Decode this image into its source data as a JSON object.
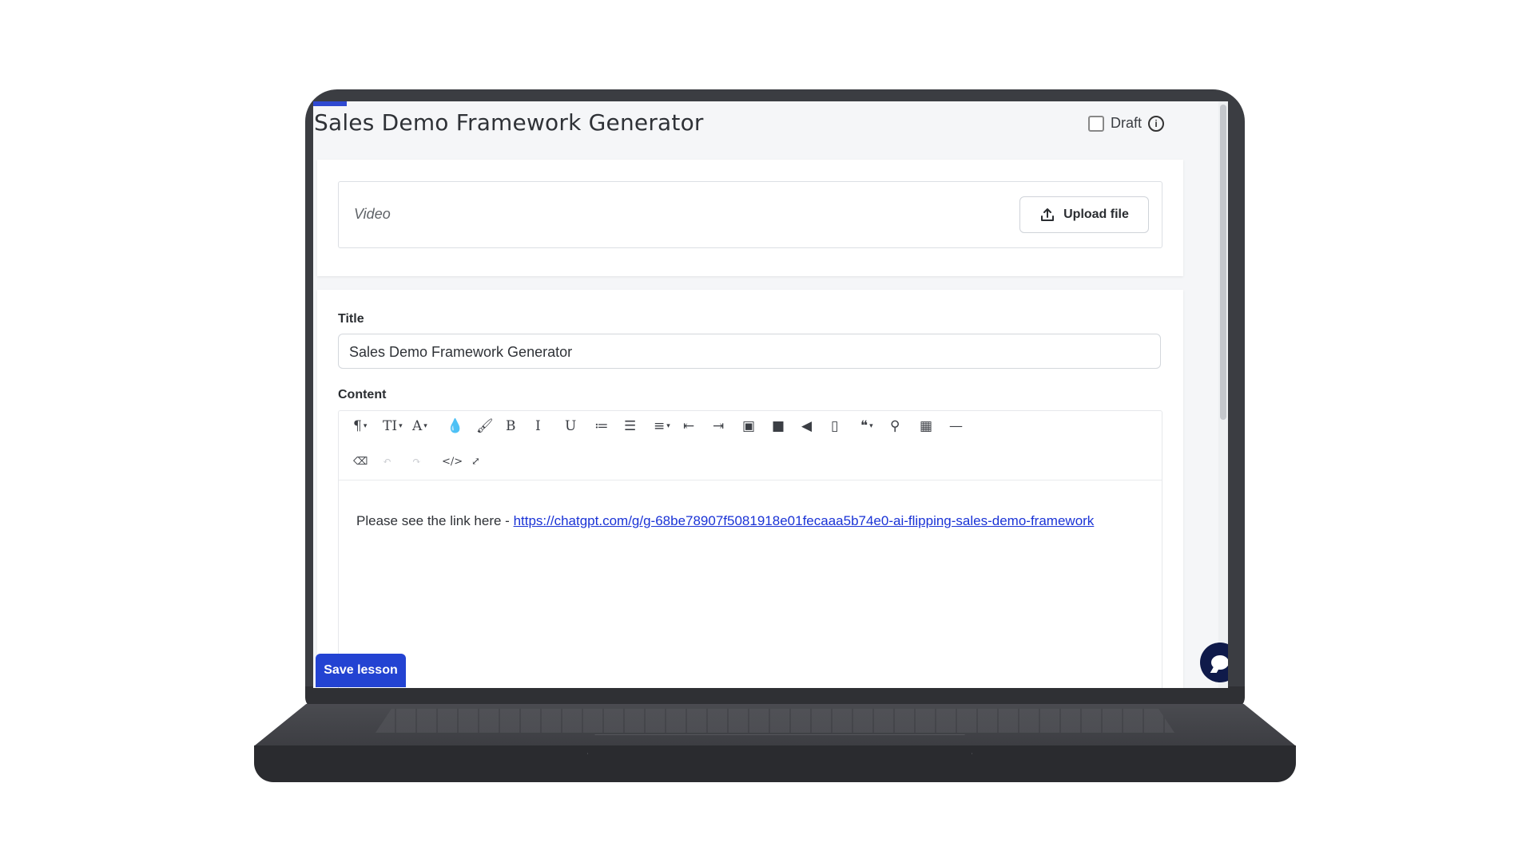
{
  "page": {
    "title": "Sales Demo Framework Generator",
    "draft_label": "Draft",
    "draft_checked": false
  },
  "video": {
    "label": "Video",
    "upload_label": "Upload file"
  },
  "form": {
    "title_label": "Title",
    "title_value": "Sales Demo Framework Generator",
    "content_label": "Content"
  },
  "editor": {
    "toolbar_row1": [
      {
        "name": "paragraph-format-icon",
        "glyph": "¶",
        "dropdown": true
      },
      {
        "name": "font-size-icon",
        "glyph": "TI",
        "dropdown": true
      },
      {
        "name": "font-family-icon",
        "glyph": "A",
        "dropdown": true
      },
      {
        "name": "text-color-icon",
        "glyph": "💧",
        "dropdown": false
      },
      {
        "name": "background-color-icon",
        "glyph": "🖌",
        "dropdown": false
      },
      {
        "name": "bold-icon",
        "glyph": "B",
        "dropdown": false
      },
      {
        "name": "italic-icon",
        "glyph": "I",
        "dropdown": false
      },
      {
        "name": "underline-icon",
        "glyph": "U",
        "dropdown": false
      },
      {
        "name": "ordered-list-icon",
        "glyph": "≔",
        "dropdown": false
      },
      {
        "name": "unordered-list-icon",
        "glyph": "☰",
        "dropdown": false
      },
      {
        "name": "align-icon",
        "glyph": "≡",
        "dropdown": true
      },
      {
        "name": "outdent-icon",
        "glyph": "⇤",
        "dropdown": false
      },
      {
        "name": "indent-icon",
        "glyph": "⇥",
        "dropdown": false
      },
      {
        "name": "image-icon",
        "glyph": "▣",
        "dropdown": false
      },
      {
        "name": "video-icon",
        "glyph": "■",
        "dropdown": false
      },
      {
        "name": "audio-icon",
        "glyph": "◀",
        "dropdown": false
      },
      {
        "name": "file-icon",
        "glyph": "▯",
        "dropdown": false
      },
      {
        "name": "quote-icon",
        "glyph": "❝",
        "dropdown": true
      },
      {
        "name": "link-icon",
        "glyph": "⚲",
        "dropdown": false
      },
      {
        "name": "table-icon",
        "glyph": "▦",
        "dropdown": false
      },
      {
        "name": "horizontal-line-icon",
        "glyph": "—",
        "dropdown": false
      }
    ],
    "toolbar_row2": [
      {
        "name": "clear-formatting-icon",
        "glyph": "⌫",
        "disabled": false
      },
      {
        "name": "undo-icon",
        "glyph": "↶",
        "disabled": true
      },
      {
        "name": "redo-icon",
        "glyph": "↷",
        "disabled": true
      },
      {
        "name": "code-view-icon",
        "glyph": "</>",
        "disabled": false
      },
      {
        "name": "fullscreen-icon",
        "glyph": "⤢",
        "disabled": false
      }
    ],
    "content_prefix": "Please see the link here - ",
    "content_link": "https://chatgpt.com/g/g-68be78907f5081918e01fecaaa5b74e0-ai-flipping-sales-demo-framework"
  },
  "actions": {
    "save_label": "Save lesson"
  },
  "colors": {
    "primary": "#2343d2",
    "link": "#1a33d6",
    "chat": "#0f1a4a"
  }
}
